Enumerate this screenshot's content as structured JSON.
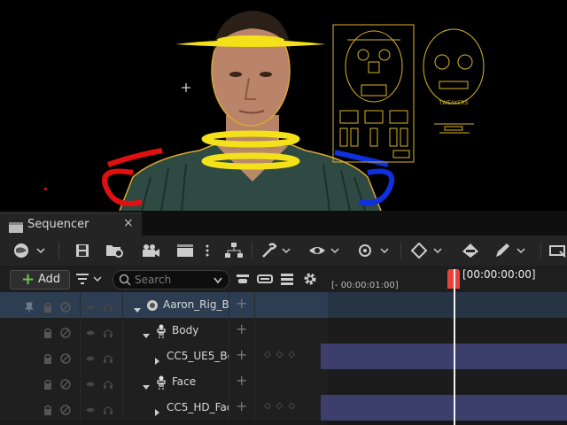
{
  "viewport": {
    "overlay_label": "TWEAKERS"
  },
  "sequencer": {
    "tab_label": "Sequencer",
    "tab_close": "×",
    "add_label": "Add",
    "add_plus": "+",
    "search_placeholder": "Search",
    "time_start": "[- 00:00:01:00]",
    "playhead_time": "[00:00:00:00]",
    "accent_color": "#e8413c",
    "selected_row_color": "#2d3e52",
    "track_color": "#3c3f6b",
    "tree": [
      {
        "label": "Aaron_Rig_B",
        "icon": "actor-icon",
        "expanded": true,
        "selected": true
      },
      {
        "label": "Body",
        "icon": "skeleton-icon",
        "expanded": true,
        "selected": false
      },
      {
        "label": "CC5_UE5_Bo",
        "icon": "component",
        "expanded": false,
        "selected": false
      },
      {
        "label": "Face",
        "icon": "skeleton-icon",
        "expanded": true,
        "selected": false
      },
      {
        "label": "CC5_HD_Fac",
        "icon": "component",
        "expanded": false,
        "selected": false
      }
    ],
    "row_plus": "+",
    "key_nav": "◇◇◇"
  }
}
